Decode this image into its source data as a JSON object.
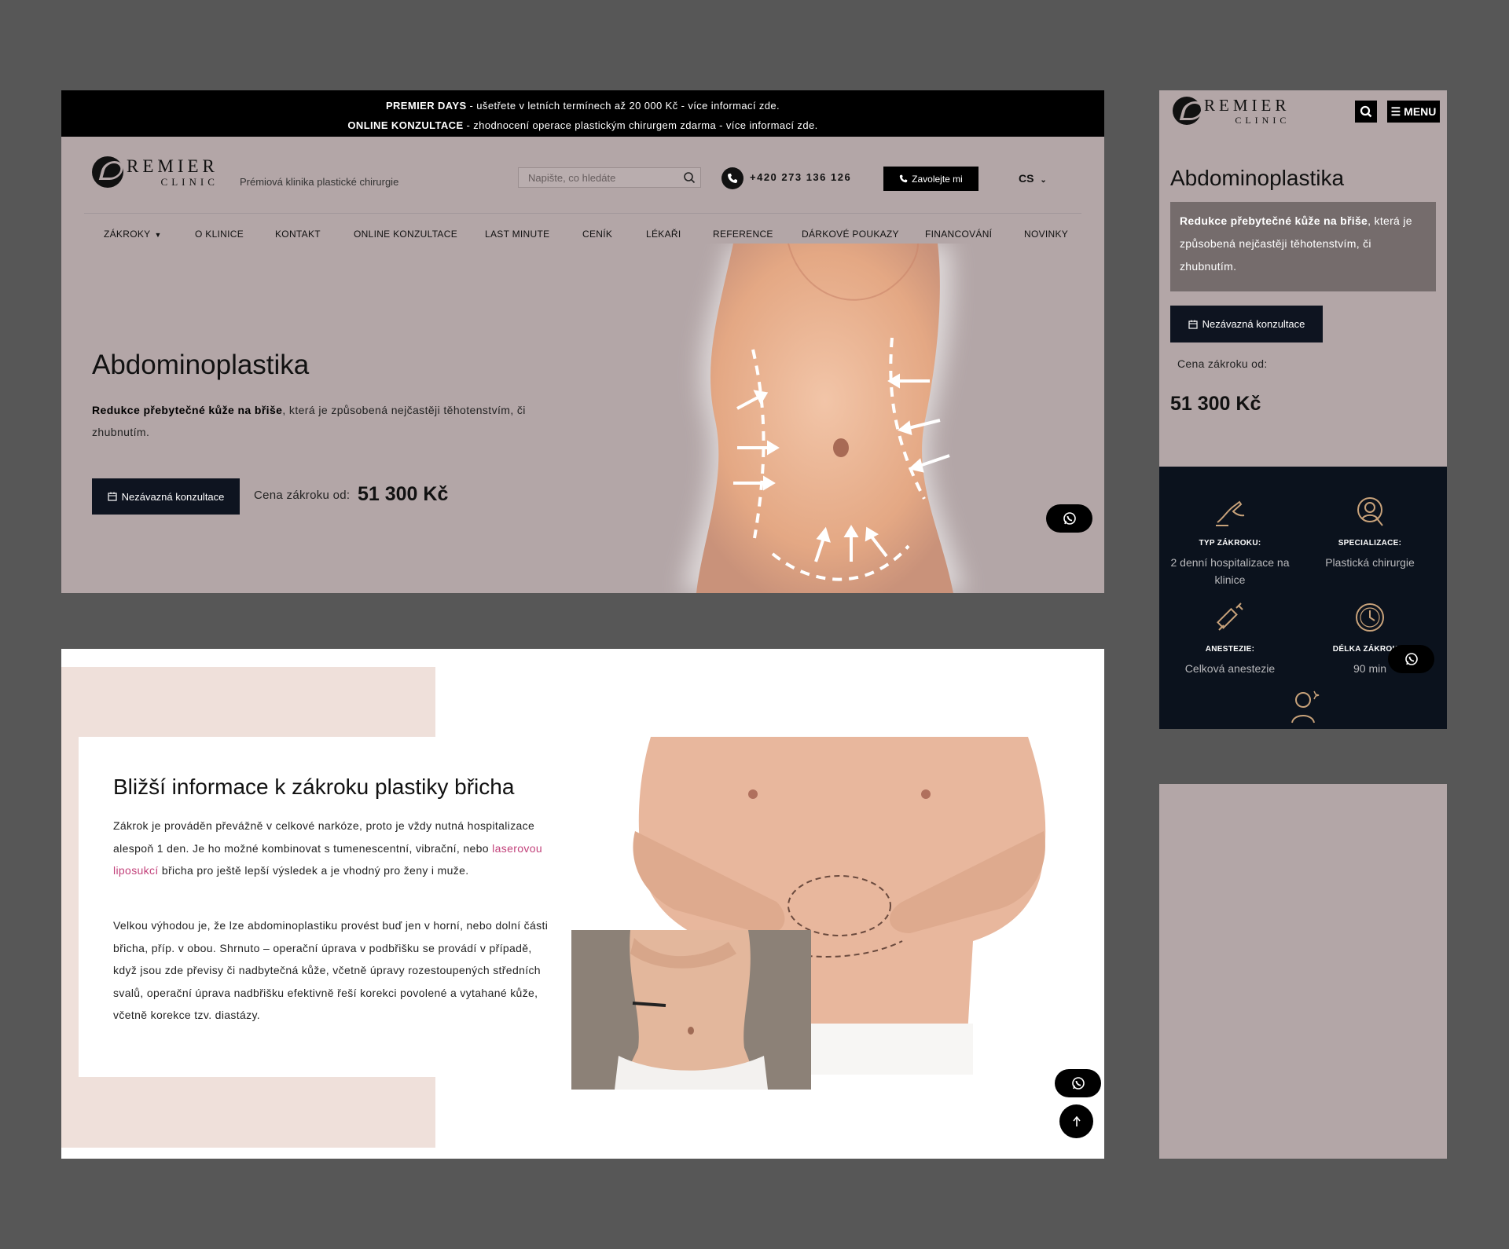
{
  "announcements": [
    {
      "bold": "PREMIER DAYS",
      "text": " - ušetřete v letních termínech až 20 000 Kč - více informací zde."
    },
    {
      "bold": "ONLINE KONZULTACE",
      "text": " - zhodnocení operace plastickým chirurgem zdarma - více informací zde."
    }
  ],
  "brand": {
    "logo_line1": "REMIER",
    "logo_line2": "CLINIC",
    "tagline": "Prémiová klinika plastické chirurgie"
  },
  "header": {
    "search_placeholder": "Napište, co hledáte",
    "phone": "+420 273 136 126",
    "call_button": "Zavolejte mi",
    "language": "CS"
  },
  "nav": [
    "ZÁKROKY",
    "O KLINICE",
    "KONTAKT",
    "ONLINE KONZULTACE",
    "LAST MINUTE",
    "CENÍK",
    "LÉKAŘI",
    "REFERENCE",
    "DÁRKOVÉ POUKAZY",
    "FINANCOVÁNÍ",
    "NOVINKY"
  ],
  "hero": {
    "title": "Abdominoplastika",
    "lead_bold": "Redukce přebytečné kůže na břiše",
    "lead_rest": ", která je způsobená nejčastěji těhotenstvím, či zhubnutím.",
    "cta": "Nezávazná konzultace",
    "price_label": "Cena zákroku od:",
    "price": "51 300 Kč"
  },
  "info": {
    "title": "Bližší informace k zákroku plastiky břicha",
    "p1_a": "Zákrok je prováděn převážně v celkové narkóze, proto je vždy nutná hospitalizace alespoň 1 den. Je ho možné kombinovat s tumenescentní, vibrační, nebo ",
    "p1_link": "laserovou liposukcí",
    "p1_b": " břicha pro ještě lepší výsledek a je vhodný pro ženy i muže.",
    "p2": "Velkou výhodou je, že lze abdominoplastiku provést buď jen v horní, nebo dolní části břicha, příp. v obou. Shrnuto – operační úprava v podbřišku se provádí v případě, když jsou zde převisy či nadbytečná kůže, včetně úpravy rozestoupených středních svalů, operační úprava nadbřišku efektivně řeší korekci povolené a vytahané kůže, včetně korekce tzv. diastázy."
  },
  "mobile": {
    "menu_label": "MENU",
    "features": [
      {
        "icon": "surgery-hand-icon",
        "title": "TYP ZÁKROKU:",
        "value": "2 denní hospitalizace na klinice"
      },
      {
        "icon": "specialization-icon",
        "title": "SPECIALIZACE:",
        "value": "Plastická chirurgie"
      },
      {
        "icon": "syringe-icon",
        "title": "ANESTEZIE:",
        "value": "Celková anestezie"
      },
      {
        "icon": "clock-icon",
        "title": "DÉLKA ZÁKROKU:",
        "value": "90 min"
      }
    ]
  },
  "colors": {
    "brand_bg": "#b3a6a7",
    "dark": "#0e1420",
    "link": "#c2417a",
    "pink_block": "#efe0da"
  }
}
